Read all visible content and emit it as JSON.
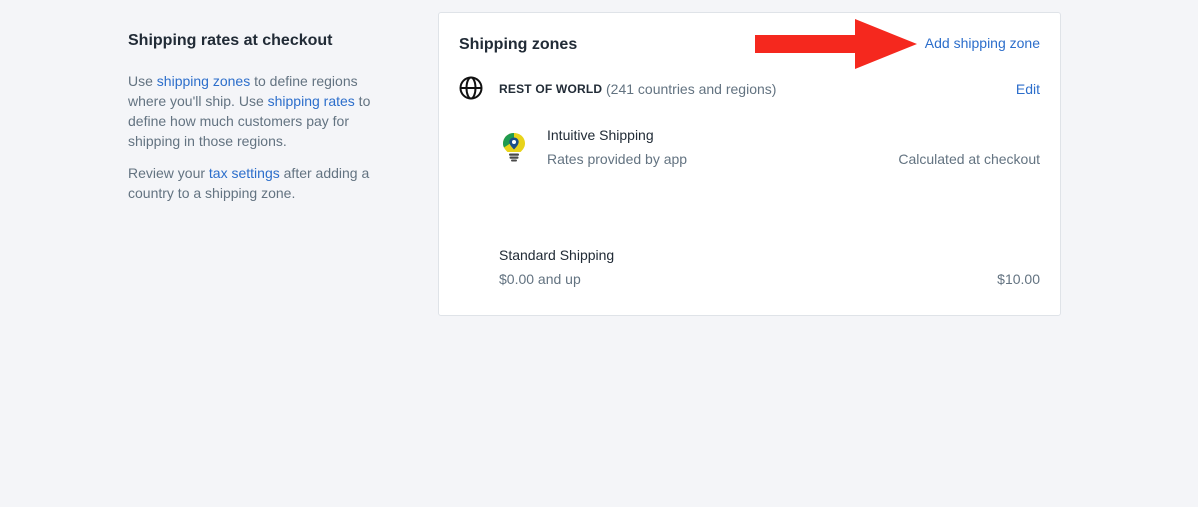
{
  "sidebar": {
    "title": "Shipping rates at checkout",
    "p1_use": "Use ",
    "p1_link1": "shipping zones",
    "p1_mid": " to define regions where you'll ship. Use ",
    "p1_link2": "shipping rates",
    "p1_end": " to define how much customers pay for shipping in those regions.",
    "p2_start": "Review your ",
    "p2_link": "tax settings",
    "p2_end": " after adding a country to a shipping zone."
  },
  "card": {
    "title": "Shipping zones",
    "add_label": "Add shipping zone",
    "arrow_color": "#f5281e",
    "zone": {
      "icon": "globe-icon",
      "name": "REST OF WORLD",
      "count": "(241 countries and regions)",
      "edit_label": "Edit"
    },
    "app": {
      "icon": "lightbulb-pin-icon",
      "name": "Intuitive Shipping",
      "subtitle": "Rates provided by app",
      "rate": "Calculated at checkout"
    },
    "rate": {
      "name": "Standard Shipping",
      "condition": "$0.00 and up",
      "price": "$10.00"
    }
  },
  "colors": {
    "link": "#2c6ecb",
    "background": "#f4f5f8",
    "text": "#212b36",
    "subdued": "#637381"
  }
}
